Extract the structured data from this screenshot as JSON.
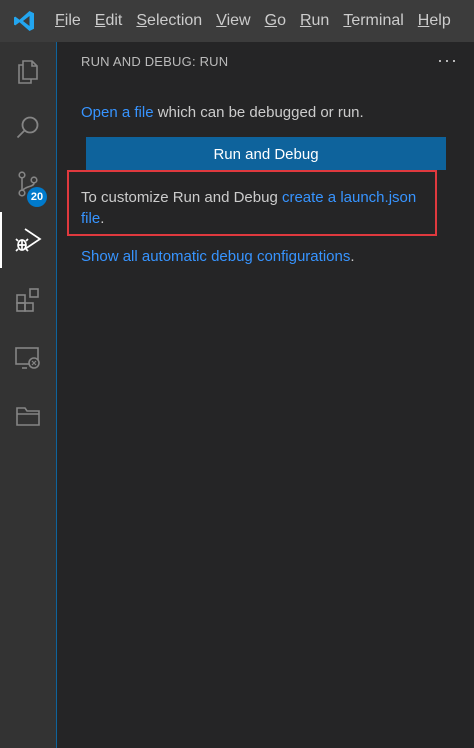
{
  "menu": {
    "items": [
      {
        "label": "File"
      },
      {
        "label": "Edit"
      },
      {
        "label": "Selection"
      },
      {
        "label": "View"
      },
      {
        "label": "Go"
      },
      {
        "label": "Run"
      },
      {
        "label": "Terminal"
      },
      {
        "label": "Help"
      }
    ]
  },
  "activity_bar": {
    "source_control_badge": "20",
    "items": [
      "explorer-icon",
      "search-icon",
      "source-control-icon",
      "run-debug-icon",
      "extensions-icon",
      "remote-explorer-icon",
      "folder-icon"
    ]
  },
  "sidebar": {
    "title": "RUN AND DEBUG: RUN",
    "more_label": "···",
    "open_file_link": "Open a file",
    "open_file_rest": " which can be debugged or run.",
    "run_button_label": "Run and Debug",
    "customize_prefix": "To customize Run and Debug ",
    "customize_link": "create a launch.json file",
    "customize_suffix": ".",
    "show_all_link": "Show all automatic debug configurations",
    "show_all_suffix": "."
  },
  "colors": {
    "accent": "#007acc",
    "button": "#0e639c",
    "link": "#3794ff",
    "highlight": "#e0393e"
  }
}
